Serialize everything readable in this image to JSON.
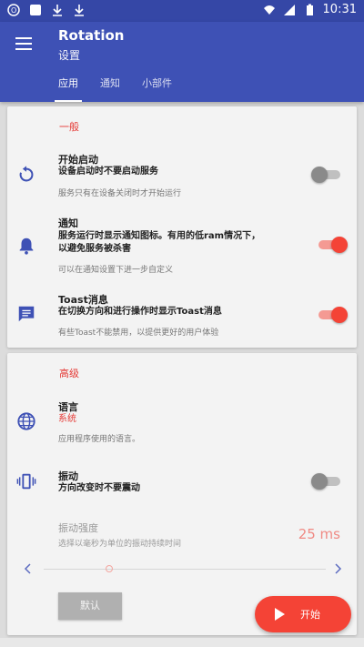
{
  "status_bar": {
    "time": "10:31",
    "icons": [
      "notification-icon",
      "app-icon",
      "download-icon",
      "download-icon",
      "wifi-icon",
      "signal-icon",
      "battery-icon"
    ]
  },
  "app_bar": {
    "title": "Rotation",
    "subtitle": "设置",
    "tabs": [
      {
        "label": "应用",
        "active": true
      },
      {
        "label": "通知",
        "active": false
      },
      {
        "label": "小部件",
        "active": false
      }
    ]
  },
  "general": {
    "section_title": "一般",
    "items": [
      {
        "icon": "restart-icon",
        "title": "开始启动",
        "subtitle": "设备启动时不要启动服务",
        "hint": "服务只有在设备关闭时才开始运行",
        "toggle": false
      },
      {
        "icon": "bell-icon",
        "title": "通知",
        "subtitle_line1": "服务运行时显示通知图标。有用的低ram情况下，",
        "subtitle_line2": "以避免服务被杀害",
        "hint": "可以在通知设置下进一步自定义",
        "toggle": true
      },
      {
        "icon": "message-icon",
        "title": "Toast消息",
        "subtitle": "在切换方向和进行操作时显示Toast消息",
        "hint": "有些Toast不能禁用，以提供更好的用户体验",
        "toggle": true
      }
    ]
  },
  "advanced": {
    "section_title": "高级",
    "language": {
      "icon": "globe-icon",
      "title": "语言",
      "value": "系统",
      "hint": "应用程序使用的语言。"
    },
    "vibration": {
      "icon": "vibrate-icon",
      "title": "振动",
      "subtitle": "方向改变时不要震动",
      "toggle": false
    },
    "vibration_strength": {
      "title": "振动强度",
      "hint": "选择以毫秒为单位的振动持续时间",
      "value": "25 ms"
    },
    "default_button": "默认"
  },
  "fab": {
    "label": "开始",
    "icon": "play-icon"
  },
  "colors": {
    "primary": "#3e51b5",
    "accent": "#f44336"
  }
}
